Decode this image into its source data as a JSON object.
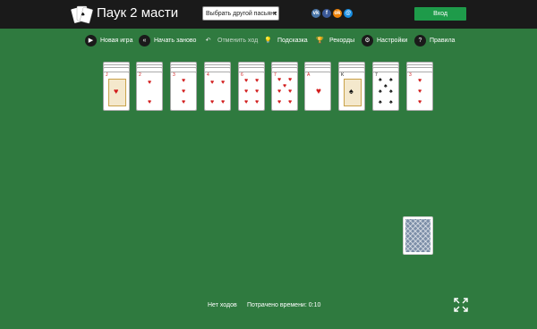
{
  "header": {
    "title": "Паук 2 масти",
    "game_select": "Выбрать другой пасьянс",
    "login_label": "Вход",
    "social": [
      {
        "name": "vk",
        "glyph": "vk",
        "color": "#4a76a8"
      },
      {
        "name": "facebook",
        "glyph": "f",
        "color": "#3b5998"
      },
      {
        "name": "odnoklassniki",
        "glyph": "ok",
        "color": "#ee8208"
      },
      {
        "name": "mailru",
        "glyph": "@",
        "color": "#168de2"
      }
    ]
  },
  "toolbar": {
    "new_game": "Новая игра",
    "restart": "Начать заново",
    "undo": "Отменить ход",
    "hint": "Подсказка",
    "records": "Рекорды",
    "settings": "Настройки",
    "rules": "Правила"
  },
  "tableau": [
    {
      "rank": "J",
      "suit": "♥",
      "face": "court"
    },
    {
      "rank": "2",
      "suit": "♥",
      "face": "pips"
    },
    {
      "rank": "3",
      "suit": "♥",
      "face": "pips"
    },
    {
      "rank": "4",
      "suit": "♥",
      "face": "pips"
    },
    {
      "rank": "6",
      "suit": "♥",
      "face": "pips"
    },
    {
      "rank": "7",
      "suit": "♥",
      "face": "pips"
    },
    {
      "rank": "A",
      "suit": "♥",
      "face": "ace"
    },
    {
      "rank": "K",
      "suit": "♠",
      "face": "court"
    },
    {
      "rank": "7",
      "suit": "♠",
      "face": "pips"
    },
    {
      "rank": "3",
      "suit": "♥",
      "face": "pips"
    }
  ],
  "status": {
    "moves": "Нет ходов",
    "time": "Потрачено времени: 0:10"
  },
  "colors": {
    "felt": "#2f7a3f",
    "topbar": "#1a1a1a",
    "login": "#1e9b4a",
    "red_suit": "#d21c1c"
  }
}
